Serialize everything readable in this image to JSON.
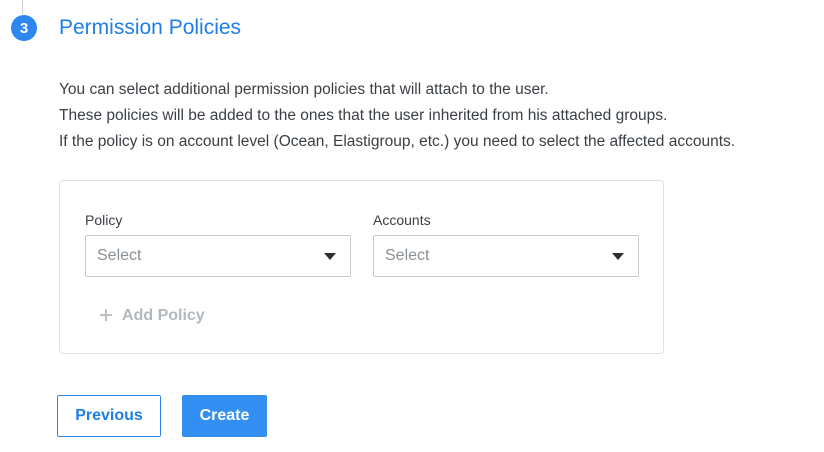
{
  "step": {
    "number": "3",
    "title": "Permission Policies"
  },
  "description": {
    "line1": "You can select additional permission policies that will attach to the user.",
    "line2": "These policies will be added to the ones that the user inherited from his attached groups.",
    "line3": "If the policy is on account level (Ocean, Elastigroup, etc.) you need to select the affected accounts."
  },
  "policy_form": {
    "policy_label": "Policy",
    "policy_placeholder": "Select",
    "accounts_label": "Accounts",
    "accounts_placeholder": "Select",
    "add_policy_label": "Add Policy",
    "add_policy_icon": "plus-icon"
  },
  "actions": {
    "previous_label": "Previous",
    "create_label": "Create"
  },
  "colors": {
    "accent": "#2e86f0",
    "title": "#1e7ee8",
    "disabled_text": "#b3b8bd"
  }
}
